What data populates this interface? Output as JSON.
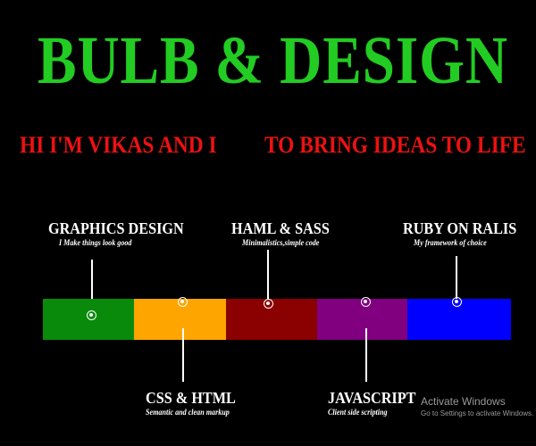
{
  "header": {
    "title": "BULB & DESIGN",
    "subtitle_left": "HI I'M VIKAS AND I",
    "subtitle_right": "TO BRING IDEAS TO LIFE"
  },
  "timeline": {
    "colors": [
      "#0a8a0a",
      "#ffa500",
      "#8b0000",
      "#800080",
      "#0000ff"
    ],
    "skills": [
      {
        "title": "GRAPHICS DESIGN",
        "desc": "I Make things look good"
      },
      {
        "title": "CSS & HTML",
        "desc": "Semantic and clean markup"
      },
      {
        "title": "HAML & SASS",
        "desc": "Minimalistics,simple code"
      },
      {
        "title": "JAVASCRIPT",
        "desc": "Client side scripting"
      },
      {
        "title": "RUBY ON RALIS",
        "desc": "My framework of choice"
      }
    ]
  },
  "watermark": {
    "line1": "Activate Windows",
    "line2": "Go to Settings to activate Windows."
  },
  "colors": {
    "title": "#22cc22",
    "subtitle": "#ee1111",
    "background": "#000000"
  }
}
